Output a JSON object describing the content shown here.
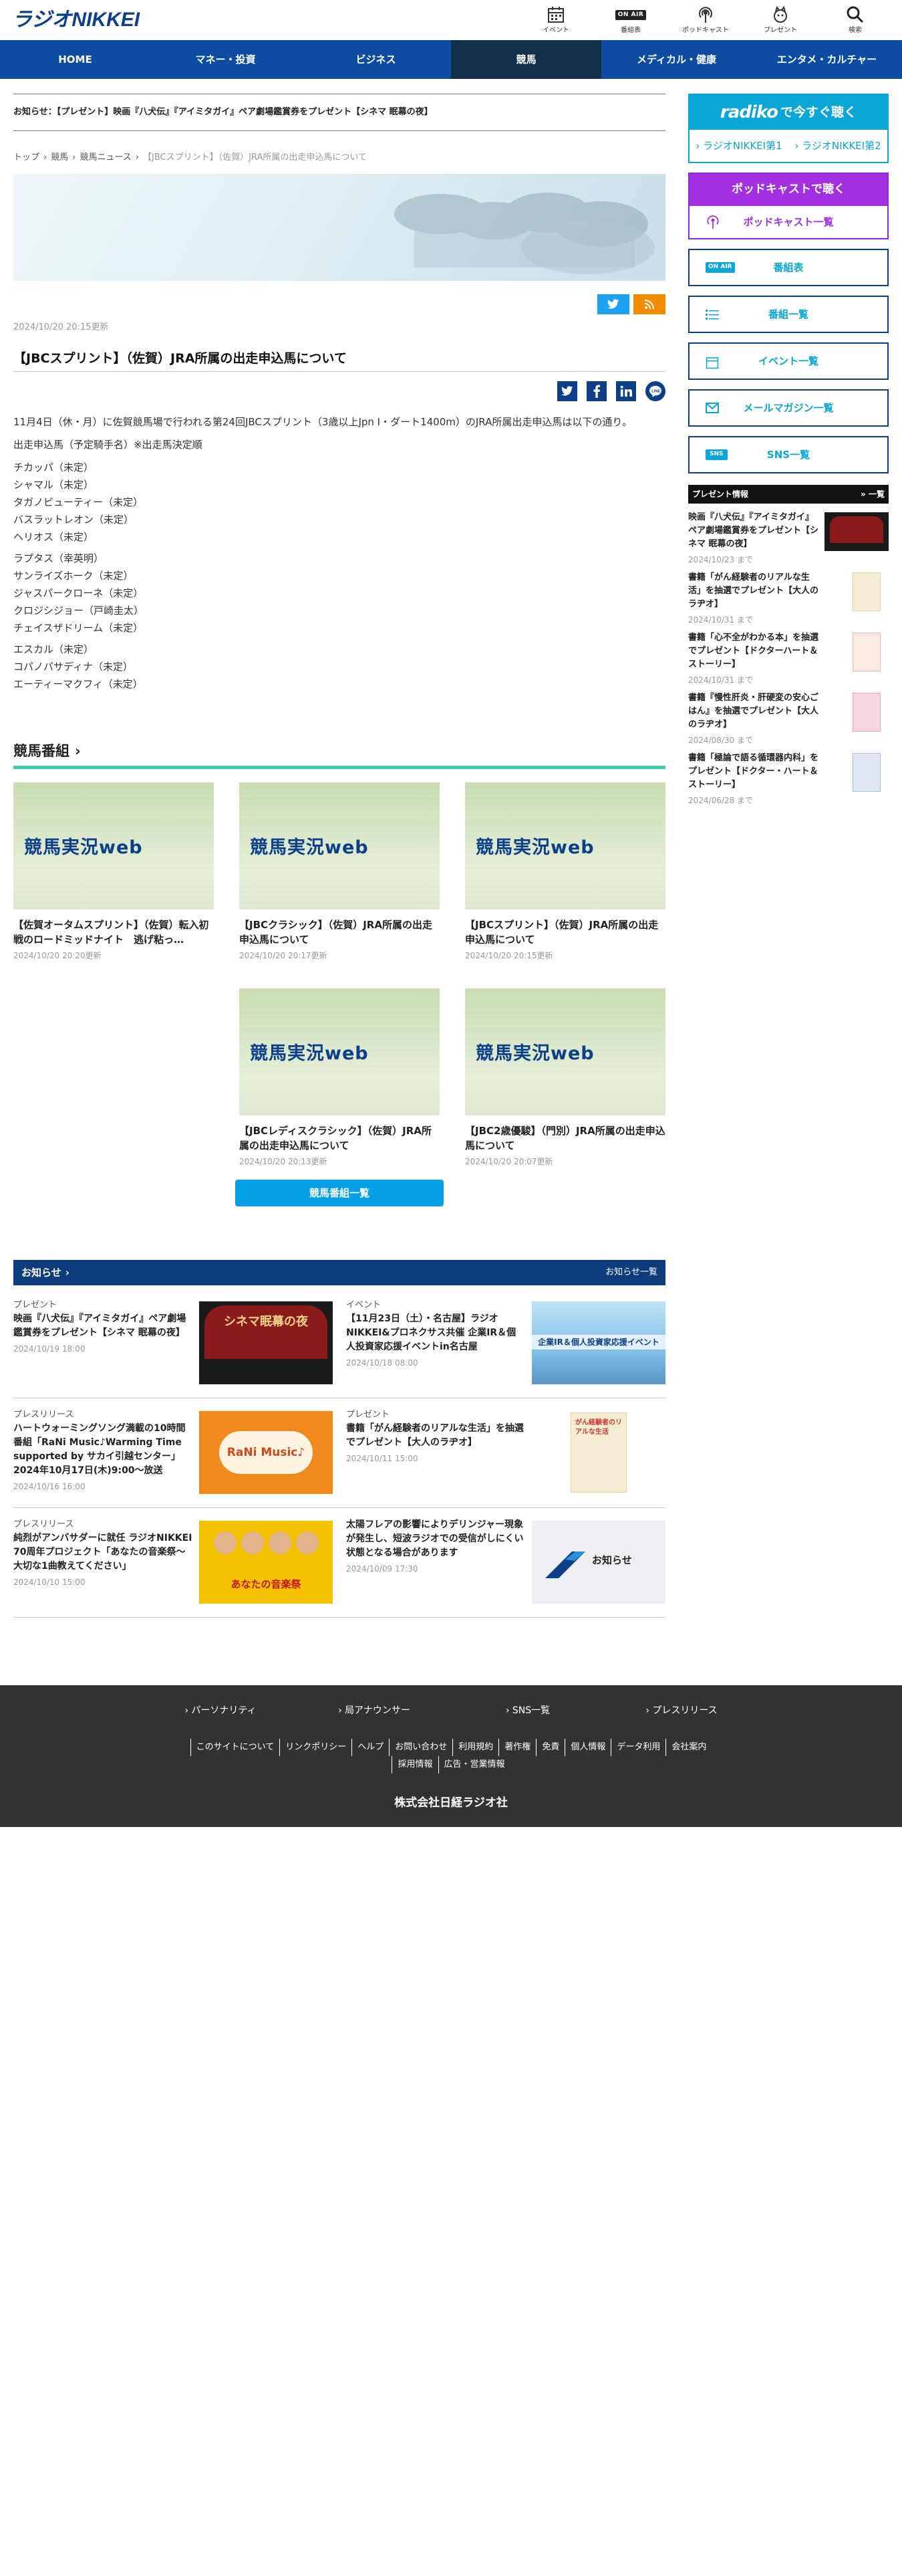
{
  "header": {
    "logo": "ラジオNIKKEI",
    "nav": [
      {
        "label": "イベント",
        "icon": "calendar-icon"
      },
      {
        "label": "番組表",
        "icon": "onair-icon",
        "badge": "ON AIR"
      },
      {
        "label": "ポッドキャスト",
        "icon": "podcast-icon"
      },
      {
        "label": "プレゼント",
        "icon": "gift-icon"
      },
      {
        "label": "検索",
        "icon": "search-icon"
      }
    ]
  },
  "gnav": [
    "HOME",
    "マネー・投資",
    "ビジネス",
    "競馬",
    "メディカル・健康",
    "エンタメ・カルチャー"
  ],
  "notice": "お知らせ：【プレゼント】映画『八犬伝』『アイミタガイ』ペア劇場鑑賞券をプレゼント【シネマ 眠幕の夜】",
  "breadcrumb": {
    "items": [
      "トップ",
      "競馬",
      "競馬ニュース"
    ],
    "current": "【JBCスプリント】（佐賀）JRA所属の出走申込馬について"
  },
  "article": {
    "date": "2024/10/20 20:15更新",
    "title": "【JBCスプリント】（佐賀）JRA所属の出走申込馬について",
    "intro": "11月4日（休・月）に佐賀競馬場で行われる第24回JBCスプリント（3歳以上Jpn I・ダート1400m）のJRA所属出走申込馬は以下の通り。",
    "sub": "出走申込馬（予定騎手名）※出走馬決定順",
    "groups": [
      [
        "チカッパ（未定）",
        "シャマル（未定）",
        "タガノビューティー（未定）",
        "バスラットレオン（未定）",
        "ヘリオス（未定）"
      ],
      [
        "ラプタス（幸英明）",
        "サンライズホーク（未定）",
        "ジャスパークローネ（未定）",
        "クロジシジョー（戸崎圭太）",
        "チェイスザドリーム（未定）"
      ],
      [
        "エスカル（未定）",
        "コパノパサディナ（未定）",
        "エーティーマクフィ（未定）"
      ]
    ]
  },
  "bangumi": {
    "heading": "競馬番組",
    "thumb_label": "競馬実況web",
    "cards": [
      {
        "title": "【佐賀オータムスプリント】（佐賀）転入初戦のロードミッドナイト　逃げ粘っ…",
        "date": "2024/10/20 20:20更新"
      },
      {
        "title": "【JBCクラシック】（佐賀）JRA所属の出走申込馬について",
        "date": "2024/10/20 20:17更新"
      },
      {
        "title": "【JBCスプリント】（佐賀）JRA所属の出走申込馬について",
        "date": "2024/10/20 20:15更新"
      },
      {
        "title": "【JBCレディスクラシック】（佐賀）JRA所属の出走申込馬について",
        "date": "2024/10/20 20:13更新"
      },
      {
        "title": "【JBC2歳優駿】（門別）JRA所属の出走申込馬について",
        "date": "2024/10/20 20:07更新"
      }
    ],
    "more": "競馬番組一覧"
  },
  "oshirase": {
    "heading": "お知らせ",
    "all": "お知らせ一覧",
    "items": [
      {
        "cat": "プレゼント",
        "title": "映画『八犬伝』『アイミタガイ』ペア劇場鑑賞券をプレゼント【シネマ 眠幕の夜】",
        "date": "2024/10/19 18:00",
        "img": "シネマ眠幕の夜"
      },
      {
        "cat": "イベント",
        "title": "【11月23日（土）・名古屋】ラジオNIKKEI&プロネクサス共催 企業IR＆個人投資家応援イベントin名古屋",
        "date": "2024/10/18 08:00",
        "img": "企業IR＆個人投資家応援イベント"
      },
      {
        "cat": "プレスリリース",
        "title": "ハートウォーミングソング満載の10時間番組「RaNi Music♪Warming Time supported by サカイ引越センター」2024年10月17日(木)9:00～放送",
        "date": "2024/10/16 16:00",
        "img": "RaNi Music♪"
      },
      {
        "cat": "プレゼント",
        "title": "書籍「がん経験者のリアルな生活」を抽選でプレゼント【大人のラヂオ】",
        "date": "2024/10/11 15:00",
        "img": "がん経験者のリアルな生活"
      },
      {
        "cat": "プレスリリース",
        "title": "純烈がアンバサダーに就任 ラジオNIKKEI 70周年プロジェクト「あなたの音楽祭～大切な1曲教えてください」",
        "date": "2024/10/10 15:00",
        "img": "あなたの音楽祭"
      },
      {
        "cat": "",
        "title": "太陽フレアの影響によりデリンジャー現象が発生し、短波ラジオでの受信がしにくい状態となる場合があります",
        "date": "2024/10/09 17:30",
        "img": "お知らせ"
      }
    ]
  },
  "sidebar": {
    "radiko_title": "radiko",
    "radiko_suffix": "で今すぐ聴く",
    "radiko_links": [
      "ラジオNIKKEI第1",
      "ラジオNIKKEI第2"
    ],
    "podcast_title": "ポッドキャストで聴く",
    "podcast_link": "ポッドキャスト一覧",
    "buttons": [
      "番組表",
      "番組一覧",
      "イベント一覧",
      "メールマガジン一覧",
      "SNS一覧"
    ],
    "onair_badge": "ON AIR",
    "sns_badge": "SNS",
    "present_head": "プレゼント情報",
    "present_all": "一覧",
    "presents": [
      {
        "title": "映画『八犬伝』『アイミタガイ』ペア劇場鑑賞券をプレゼント【シネマ 眠幕の夜】",
        "date": "2024/10/23 まで"
      },
      {
        "title": "書籍「がん経験者のリアルな生活」を抽選でプレゼント【大人のラヂオ】",
        "date": "2024/10/31 まで"
      },
      {
        "title": "書籍「心不全がわかる本」を抽選でプレゼント【ドクターハート＆ストーリー】",
        "date": "2024/10/31 まで"
      },
      {
        "title": "書籍『慢性肝炎・肝硬変の安心ごはん』を抽選でプレゼント【大人のラヂオ】",
        "date": "2024/08/30 まで"
      },
      {
        "title": "書籍「極論で語る循環器内科」をプレゼント【ドクター・ハート＆ストーリー】",
        "date": "2024/06/28 まで"
      }
    ]
  },
  "footer": {
    "links1": [
      "パーソナリティ",
      "局アナウンサー",
      "SNS一覧",
      "プレスリリース"
    ],
    "links2": [
      "このサイトについて",
      "リンクポリシー",
      "ヘルプ",
      "お問い合わせ",
      "利用規約",
      "著作権",
      "免責",
      "個人情報",
      "データ利用",
      "会社案内",
      "採用情報",
      "広告・営業情報"
    ],
    "copyright": "株式会社日経ラジオ社"
  },
  "colors": {
    "brand_blue": "#0c4da2",
    "active_nav": "#13304a",
    "radiko": "#0aa6d6",
    "podcast": "#a230e0",
    "accent_green": "#3ec9b0",
    "footer": "#323232"
  }
}
